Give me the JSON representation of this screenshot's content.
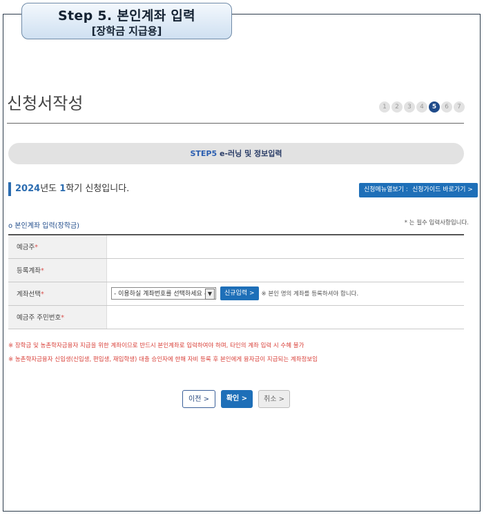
{
  "step_header": {
    "title": "Step 5. 본인계좌 입력",
    "subtitle": "[장학금 지급용]"
  },
  "page": {
    "title": "신청서작성"
  },
  "step_indicator": {
    "steps": [
      "1",
      "2",
      "3",
      "4",
      "5",
      "6",
      "7"
    ],
    "current": "5"
  },
  "banner": {
    "step_label": "STEP5",
    "text": "e-러닝 및 정보입력"
  },
  "semester": {
    "year": "2024",
    "year_suffix": "년도 ",
    "term": "1",
    "term_suffix": "학기 신청입니다."
  },
  "top_buttons": {
    "menu_view": "신청메뉴열보기 >",
    "guide": "신청가이드 바로가기 >"
  },
  "section": {
    "label": "o 본인계좌 입력(장학금)",
    "required_note": "* 는 필수 입력사항입니다."
  },
  "form": {
    "depositor_label": "예금주",
    "registered_account_label": "등록계좌",
    "account_select_label": "계좌선택",
    "select_placeholder": "- 이용하실 계좌번호를 선택하세요 -",
    "new_input_button": "신규입력 >",
    "account_note": "※ 본인 명의 계좌를 등록하셔야 합니다.",
    "resident_number_label": "예금주 주민번호",
    "required_mark": "*"
  },
  "warnings": [
    "※ 장학금 및 농촌학자금융자 지급을 위한 계좌이므로 반드시 본인계좌로 입력하여야 하며, 타인의 계좌 입력 시 수혜 불가",
    "※ 농촌학자금융자 신입생(신입생, 편입생, 재입학생) 대출 승인자에 한해 자비 등록 후 본인에게 융자금이 지급되는 계좌정보임"
  ],
  "buttons": {
    "prev": "이전 >",
    "ok": "확인 >",
    "cancel": "취소 >"
  }
}
